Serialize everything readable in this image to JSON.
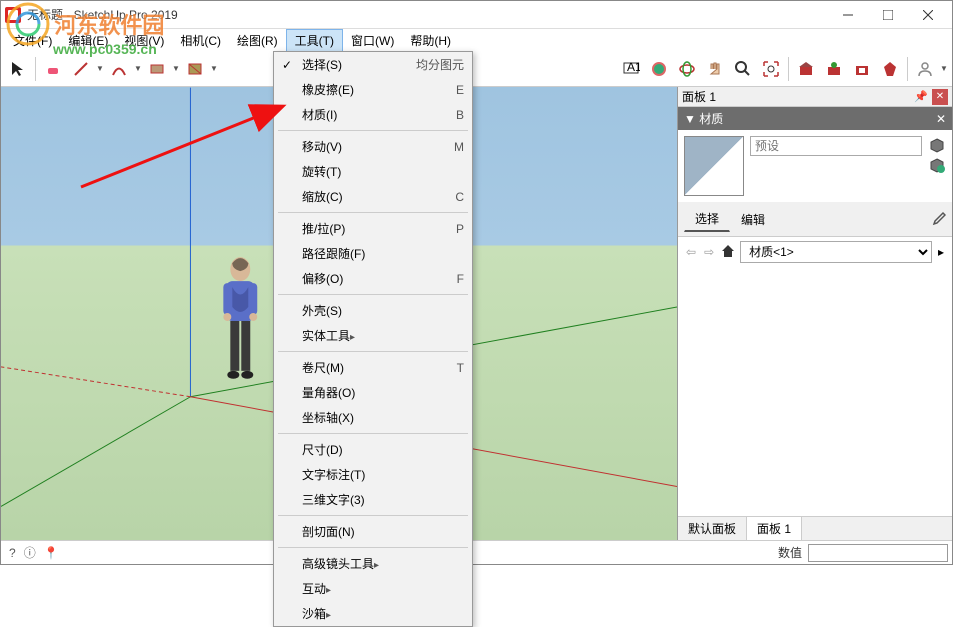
{
  "title": "无标题 - SketchUp Pro 2019",
  "menubar": [
    "文件(F)",
    "编辑(E)",
    "视图(V)",
    "相机(C)",
    "绘图(R)",
    "工具(T)",
    "窗口(W)",
    "帮助(H)"
  ],
  "active_menu_index": 5,
  "dropdown": {
    "groups": [
      [
        {
          "label": "选择(S)",
          "shortcut": "均分图元",
          "checked": true
        },
        {
          "label": "橡皮擦(E)",
          "shortcut": "E"
        },
        {
          "label": "材质(I)",
          "shortcut": "B"
        }
      ],
      [
        {
          "label": "移动(V)",
          "shortcut": "M"
        },
        {
          "label": "旋转(T)",
          "shortcut": ""
        },
        {
          "label": "缩放(C)",
          "shortcut": "C"
        }
      ],
      [
        {
          "label": "推/拉(P)",
          "shortcut": "P"
        },
        {
          "label": "路径跟随(F)",
          "shortcut": ""
        },
        {
          "label": "偏移(O)",
          "shortcut": "F"
        }
      ],
      [
        {
          "label": "外壳(S)",
          "shortcut": ""
        },
        {
          "label": "实体工具",
          "submenu": true
        }
      ],
      [
        {
          "label": "卷尺(M)",
          "shortcut": "T"
        },
        {
          "label": "量角器(O)",
          "shortcut": ""
        },
        {
          "label": "坐标轴(X)",
          "shortcut": ""
        }
      ],
      [
        {
          "label": "尺寸(D)",
          "shortcut": ""
        },
        {
          "label": "文字标注(T)",
          "shortcut": ""
        },
        {
          "label": "三维文字(3)",
          "shortcut": ""
        }
      ],
      [
        {
          "label": "剖切面(N)",
          "shortcut": ""
        }
      ],
      [
        {
          "label": "高级镜头工具",
          "submenu": true
        },
        {
          "label": "互动",
          "submenu": true
        },
        {
          "label": "沙箱",
          "submenu": true
        }
      ]
    ]
  },
  "panel": {
    "title": "面板 1",
    "section": "材质",
    "preset_label": "预设",
    "tabs": [
      "选择",
      "编辑"
    ],
    "active_tab": 0,
    "material_name": "材质<1>",
    "bottom_tabs": [
      "默认面板",
      "面板 1"
    ],
    "active_bottom_tab": 1
  },
  "status": {
    "value_label": "数值"
  },
  "watermark": {
    "text": "河东软件园",
    "url": "www.pc0359.cn"
  }
}
